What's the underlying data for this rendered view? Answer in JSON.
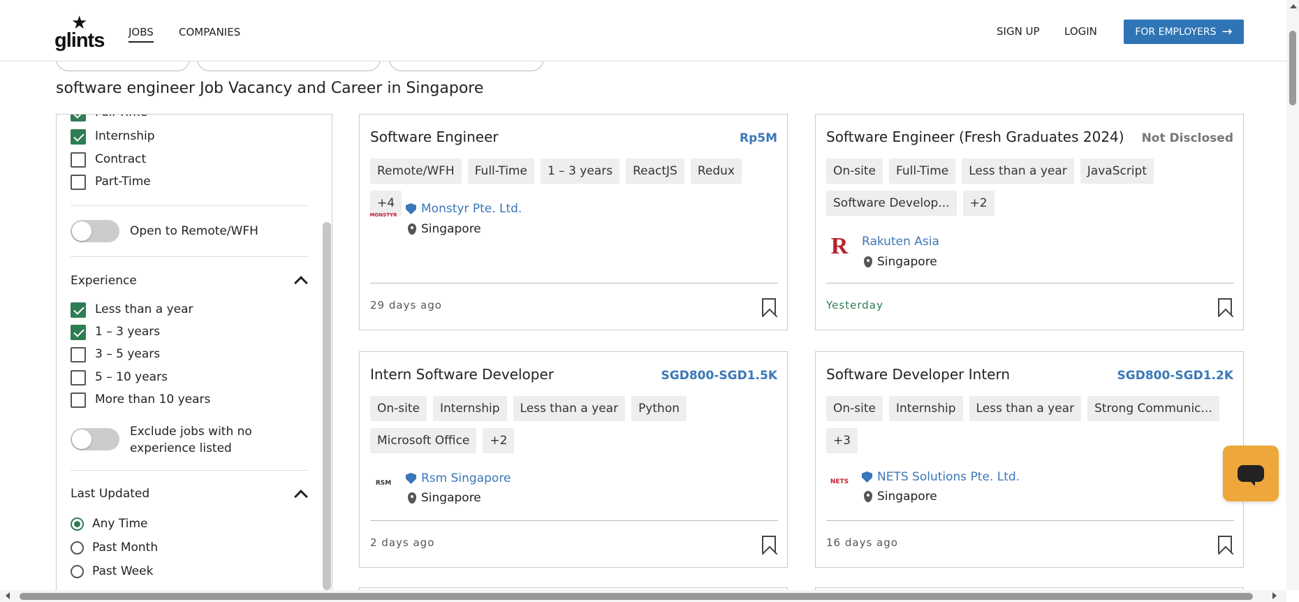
{
  "header": {
    "logo_text": "glints",
    "nav": {
      "jobs": "JOBS",
      "companies": "COMPANIES"
    },
    "signup": "SIGN UP",
    "login": "LOGIN",
    "employers": "FOR EMPLOYERS"
  },
  "page_title": "software engineer Job Vacancy and Career in Singapore",
  "sidebar": {
    "job_types": [
      {
        "label": "Full-Time",
        "checked": true
      },
      {
        "label": "Internship",
        "checked": true
      },
      {
        "label": "Contract",
        "checked": false
      },
      {
        "label": "Part-Time",
        "checked": false
      }
    ],
    "remote_toggle": "Open to Remote/WFH",
    "experience_title": "Experience",
    "experience": [
      {
        "label": "Less than a year",
        "checked": true
      },
      {
        "label": "1 – 3 years",
        "checked": true
      },
      {
        "label": "3 – 5 years",
        "checked": false
      },
      {
        "label": "5 – 10 years",
        "checked": false
      },
      {
        "label": "More than 10 years",
        "checked": false
      }
    ],
    "exclude_toggle_line1": "Exclude jobs with no",
    "exclude_toggle_line2": "experience listed",
    "last_updated_title": "Last Updated",
    "last_updated": [
      {
        "label": "Any Time",
        "selected": true
      },
      {
        "label": "Past Month",
        "selected": false
      },
      {
        "label": "Past Week",
        "selected": false
      }
    ]
  },
  "jobs": [
    {
      "title": "Software Engineer",
      "salary": "Rp5M",
      "tags": [
        "Remote/WFH",
        "Full-Time",
        "1 – 3 years",
        "ReactJS",
        "Redux",
        "+4"
      ],
      "company": "Monstyr Pte. Ltd.",
      "company_logo": "MONSTYR",
      "location": "Singapore",
      "posted": "29 days ago"
    },
    {
      "title": "Software Engineer (Fresh Graduates 2024)",
      "salary": "Not Disclosed",
      "tags": [
        "On-site",
        "Full-Time",
        "Less than a year",
        "JavaScript",
        "Software Develop...",
        "+2"
      ],
      "company": "Rakuten Asia",
      "company_logo": "R",
      "location": "Singapore",
      "posted": "Yesterday"
    },
    {
      "title": "Intern Software Developer",
      "salary": "SGD800-SGD1.5K",
      "tags": [
        "On-site",
        "Internship",
        "Less than a year",
        "Python",
        "Microsoft Office",
        "+2"
      ],
      "company": "Rsm Singapore",
      "company_logo": "RSM",
      "location": "Singapore",
      "posted": "2 days ago"
    },
    {
      "title": "Software Developer Intern",
      "salary": "SGD800-SGD1.2K",
      "tags": [
        "On-site",
        "Internship",
        "Less than a year",
        "Strong Communic...",
        "+3"
      ],
      "company": "NETS Solutions Pte. Ltd.",
      "company_logo": "NETS",
      "location": "Singapore",
      "posted": "16 days ago"
    }
  ],
  "icons": {
    "logo": "star-icon",
    "employers_arrow": "arrow-right-icon",
    "verified": "shield-check-icon",
    "location": "map-pin-icon",
    "save": "bookmark-icon",
    "chat": "chat-icon"
  },
  "colors": {
    "accent": "#2f74b5",
    "link": "#3a77b8",
    "check": "#2e7d55",
    "chat": "#eda73a"
  }
}
